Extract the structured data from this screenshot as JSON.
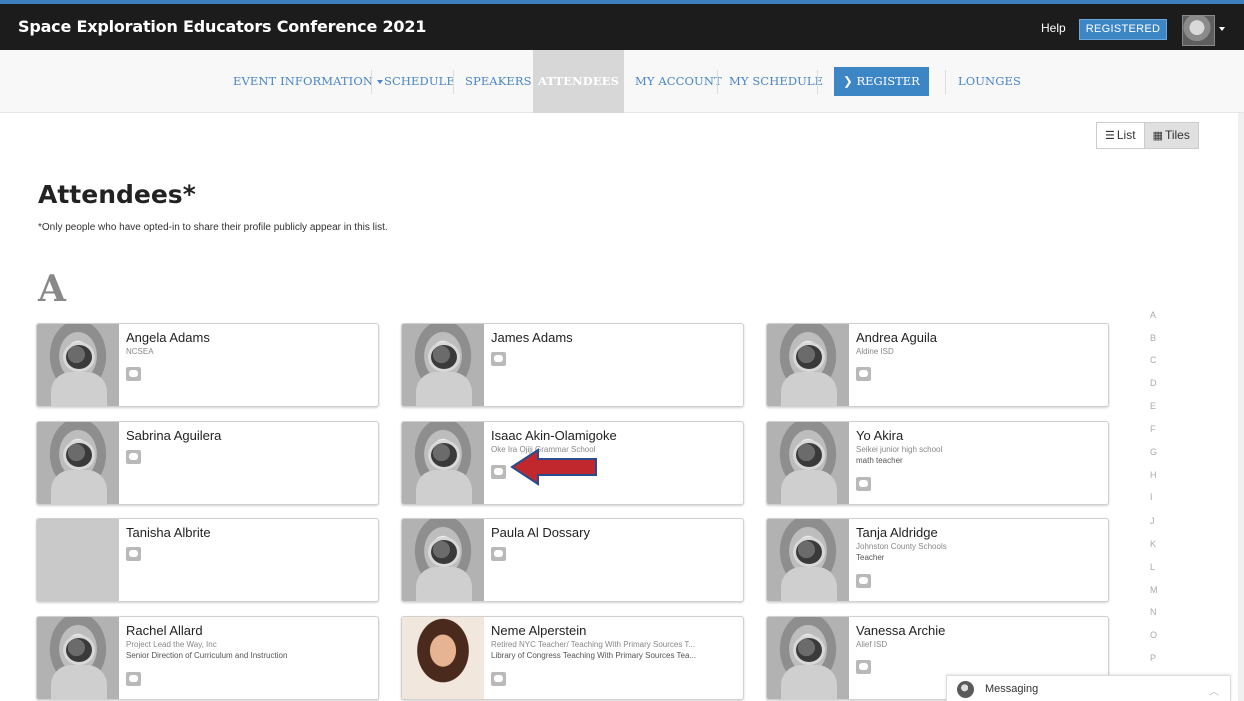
{
  "header": {
    "title": "Space Exploration Educators Conference 2021",
    "help": "Help",
    "registered": "REGISTERED"
  },
  "nav": {
    "event_information": "EVENT INFORMATION",
    "schedule": "SCHEDULE",
    "speakers": "SPEAKERS",
    "attendees": "ATTENDEES",
    "my_account": "MY ACCOUNT",
    "my_schedule": "MY SCHEDULE",
    "register": "REGISTER",
    "lounges": "LOUNGES"
  },
  "view": {
    "list": "List",
    "tiles": "Tiles",
    "selected": "Tiles"
  },
  "page": {
    "title": "Attendees*",
    "note": "*Only people who have opted-in to share their profile publicly appear in this list.",
    "section": "A"
  },
  "attendees": [
    {
      "name": "Angela Adams",
      "org": "NCSEA",
      "title": ""
    },
    {
      "name": "James Adams",
      "org": "",
      "title": ""
    },
    {
      "name": "Andrea Aguila",
      "org": "Aldine ISD",
      "title": ""
    },
    {
      "name": "Sabrina Aguilera",
      "org": "",
      "title": ""
    },
    {
      "name": "Isaac Akin-Olamigoke",
      "org": "Oke Ira Ojiji Grammar School",
      "title": ""
    },
    {
      "name": "Yo Akira",
      "org": "Seikei junior high school",
      "title": "math teacher"
    },
    {
      "name": "Tanisha Albrite",
      "org": "",
      "title": ""
    },
    {
      "name": "Paula Al Dossary",
      "org": "",
      "title": ""
    },
    {
      "name": "Tanja Aldridge",
      "org": "Johnston County Schools",
      "title": "Teacher"
    },
    {
      "name": "Rachel Allard",
      "org": "Project Lead the Way, Inc",
      "title": "Senior Direction of Curriculum and Instruction"
    },
    {
      "name": "Neme Alperstein",
      "org": "Retired NYC Teacher/ Teaching With Primary Sources T...",
      "title": "Library of Congress Teaching With Primary Sources Tea..."
    },
    {
      "name": "Vanessa Archie",
      "org": "Alief ISD",
      "title": ""
    }
  ],
  "alphabet": [
    "A",
    "B",
    "C",
    "D",
    "E",
    "F",
    "G",
    "H",
    "I",
    "J",
    "K",
    "L",
    "M",
    "N",
    "O",
    "P"
  ],
  "messaging": {
    "label": "Messaging"
  },
  "icons": [
    "user-avatar-icon",
    "caret-down-icon",
    "list-icon",
    "tiles-icon",
    "chat-icon",
    "chevron-right-icon",
    "chevron-up-icon"
  ],
  "colors": {
    "accent": "#3d86c6",
    "topbar": "#1c1c1c",
    "annotation_arrow": "#c0282d"
  }
}
